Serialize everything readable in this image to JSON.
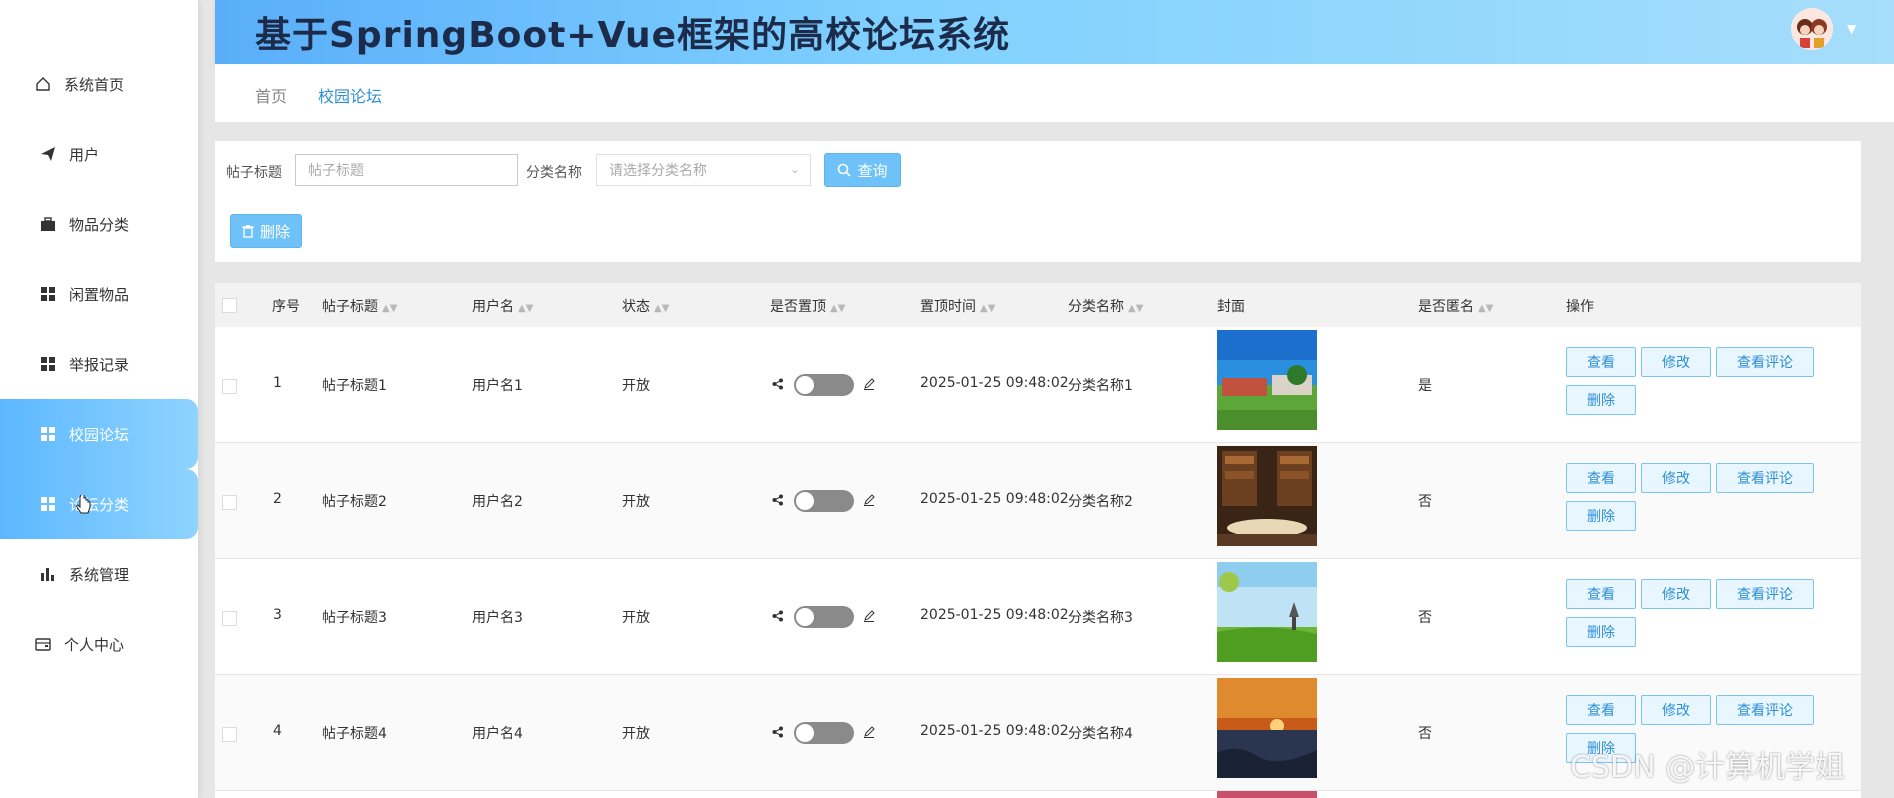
{
  "app": {
    "title": "基于SpringBoot+Vue框架的高校论坛系统"
  },
  "sidebar": {
    "items": [
      {
        "label": "系统首页",
        "icon": "home-icon"
      },
      {
        "label": "用户",
        "icon": "paper-plane-icon"
      },
      {
        "label": "物品分类",
        "icon": "briefcase-icon"
      },
      {
        "label": "闲置物品",
        "icon": "grid-icon"
      },
      {
        "label": "举报记录",
        "icon": "grid-icon"
      },
      {
        "label": "校园论坛",
        "icon": "grid-icon",
        "active": true
      },
      {
        "label": "论坛分类",
        "icon": "grid-icon",
        "hover": true
      },
      {
        "label": "系统管理",
        "icon": "bar-chart-icon"
      },
      {
        "label": "个人中心",
        "icon": "wallet-icon"
      }
    ]
  },
  "breadcrumb": {
    "home": "首页",
    "current": "校园论坛"
  },
  "search": {
    "title_label": "帖子标题",
    "title_placeholder": "帖子标题",
    "category_label": "分类名称",
    "category_placeholder": "请选择分类名称",
    "query_button": "查询",
    "delete_button": "删除"
  },
  "table": {
    "headers": [
      "序号",
      "帖子标题",
      "用户名",
      "状态",
      "是否置顶",
      "置顶时间",
      "分类名称",
      "封面",
      "是否匿名",
      "操作"
    ],
    "rows": [
      {
        "index": "1",
        "title": "帖子标题1",
        "user": "用户名1",
        "status": "开放",
        "top_time": "2025-01-25 09:48:02",
        "category": "分类名称1",
        "anonymous": "是"
      },
      {
        "index": "2",
        "title": "帖子标题2",
        "user": "用户名2",
        "status": "开放",
        "top_time": "2025-01-25 09:48:02",
        "category": "分类名称2",
        "anonymous": "否"
      },
      {
        "index": "3",
        "title": "帖子标题3",
        "user": "用户名3",
        "status": "开放",
        "top_time": "2025-01-25 09:48:02",
        "category": "分类名称3",
        "anonymous": "否"
      },
      {
        "index": "4",
        "title": "帖子标题4",
        "user": "用户名4",
        "status": "开放",
        "top_time": "2025-01-25 09:48:02",
        "category": "分类名称4",
        "anonymous": "否"
      }
    ],
    "actions": {
      "view": "查看",
      "edit": "修改",
      "view_comments": "查看评论",
      "delete": "删除"
    }
  },
  "watermark": "CSDN @计算机学姐",
  "colors": {
    "accent": "#6fc2f7",
    "header_start": "#5aaef9",
    "header_end": "#a6defb",
    "link": "#2d8fd5"
  }
}
